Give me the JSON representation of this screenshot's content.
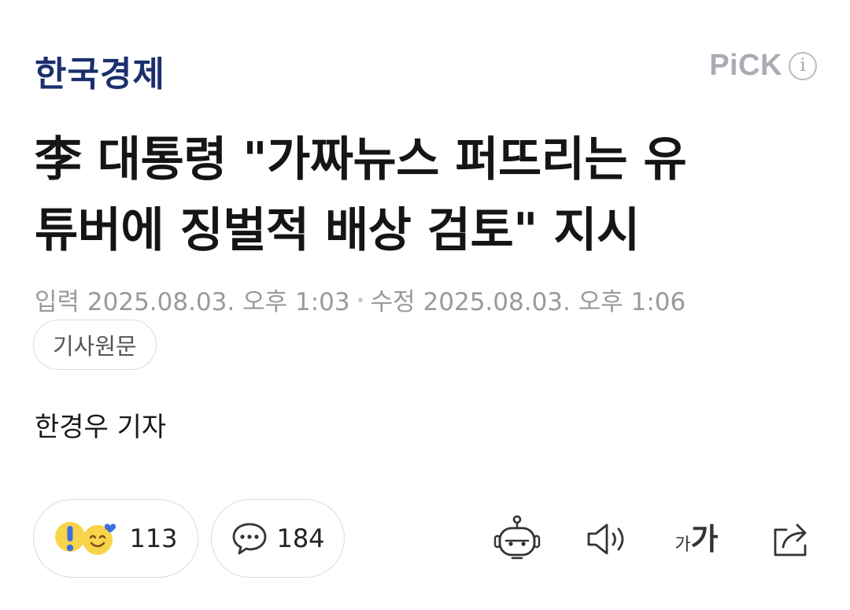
{
  "publisher": {
    "name": "한국경제"
  },
  "pick": {
    "label": "PiCK"
  },
  "article": {
    "headline_line1": "李 대통령 \"가짜뉴스 퍼뜨리는 유",
    "headline_line2": "튜버에 징벌적 배상 검토\" 지시",
    "input_label": "입력",
    "input_date": "2025.08.03. 오후 1:03",
    "modified_label": "수정",
    "modified_date": "2025.08.03. 오후 1:06",
    "original_button": "기사원문",
    "reporter": "한경우 기자"
  },
  "reactions": {
    "count": "113"
  },
  "comments": {
    "count": "184"
  },
  "toolbar": {
    "font_small": "가",
    "font_big": "가",
    "icons": [
      "robot-summary-icon",
      "speaker-icon",
      "font-size-icon",
      "share-icon"
    ]
  },
  "colors": {
    "logo": "#1b2f6e",
    "meta_gray": "#9a9a9a",
    "pick_gray": "#a8acb3"
  }
}
